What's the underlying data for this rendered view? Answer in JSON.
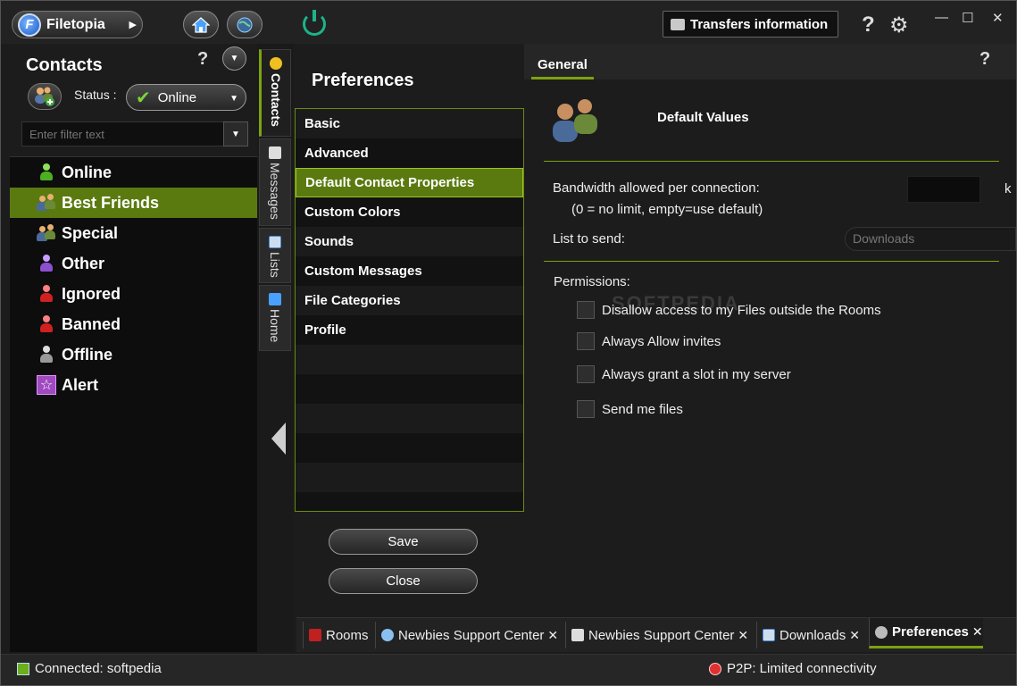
{
  "app": {
    "name": "Filetopia",
    "transfers_label": "Transfers information",
    "help_glyph": "?",
    "settings_glyph": "⚙",
    "minimize_glyph": "—",
    "maximize_glyph": "☐",
    "close_glyph": "✕"
  },
  "contacts": {
    "title": "Contacts",
    "help_glyph": "?",
    "status_label": "Status :",
    "status_value": "Online",
    "search_placeholder": "Enter filter text",
    "groups": [
      {
        "label": "Online",
        "icon": "person-green-icon",
        "selected": false
      },
      {
        "label": "Best Friends",
        "icon": "friends-icon",
        "selected": true
      },
      {
        "label": "Special",
        "icon": "friends-icon",
        "selected": false
      },
      {
        "label": "Other",
        "icon": "person-purple-icon",
        "selected": false
      },
      {
        "label": "Ignored",
        "icon": "person-red-icon",
        "selected": false
      },
      {
        "label": "Banned",
        "icon": "person-red-icon",
        "selected": false
      },
      {
        "label": "Offline",
        "icon": "person-gray-icon",
        "selected": false
      },
      {
        "label": "Alert",
        "icon": "star-icon",
        "selected": false
      }
    ]
  },
  "vtabs": [
    {
      "label": "Contacts",
      "icon": "smiley-icon",
      "active": true
    },
    {
      "label": "Messages",
      "icon": "messages-icon",
      "active": false
    },
    {
      "label": "Lists",
      "icon": "lists-icon",
      "active": false
    },
    {
      "label": "Home",
      "icon": "home-icon",
      "active": false
    }
  ],
  "preferences": {
    "title": "Preferences",
    "items": [
      {
        "label": "Basic",
        "selected": false
      },
      {
        "label": "Advanced",
        "selected": false
      },
      {
        "label": "Default Contact Properties",
        "selected": true
      },
      {
        "label": "Custom Colors",
        "selected": false
      },
      {
        "label": "Sounds",
        "selected": false
      },
      {
        "label": "Custom Messages",
        "selected": false
      },
      {
        "label": "File Categories",
        "selected": false
      },
      {
        "label": "Profile",
        "selected": false
      }
    ],
    "save_label": "Save",
    "close_label": "Close"
  },
  "general": {
    "tab_label": "General",
    "help_glyph": "?",
    "section_title": "Default Values",
    "bandwidth_label": "Bandwidth allowed per connection:",
    "bandwidth_unit": "k",
    "bandwidth_hint": "(0 = no limit, empty=use default)",
    "list_label": "List to send:",
    "list_value": "Downloads",
    "permissions_label": "Permissions:",
    "watermark": "SOFTPEDIA",
    "checkboxes": [
      {
        "label": "Disallow access to my Files outside the Rooms",
        "checked": false
      },
      {
        "label": "Always Allow invites",
        "checked": false
      },
      {
        "label": "Always grant a slot in my server",
        "checked": false
      },
      {
        "label": "Send me files",
        "checked": false
      }
    ]
  },
  "bottom_tabs": [
    {
      "label": "Rooms",
      "icon": "rooms-icon",
      "closable": false,
      "active": false
    },
    {
      "label": "Newbies Support Center",
      "icon": "chat-icon",
      "closable": true,
      "active": false
    },
    {
      "label": "Newbies Support Center",
      "icon": "list-icon",
      "closable": true,
      "active": false
    },
    {
      "label": "Downloads",
      "icon": "downloads-icon",
      "closable": true,
      "active": false
    },
    {
      "label": "Preferences",
      "icon": "gear-icon",
      "closable": true,
      "active": true
    }
  ],
  "statusbar": {
    "connected": "Connected: softpedia",
    "p2p": "P2P: Limited connectivity"
  },
  "colors": {
    "accent": "#5a7a10",
    "accent_border": "#7da20f"
  }
}
